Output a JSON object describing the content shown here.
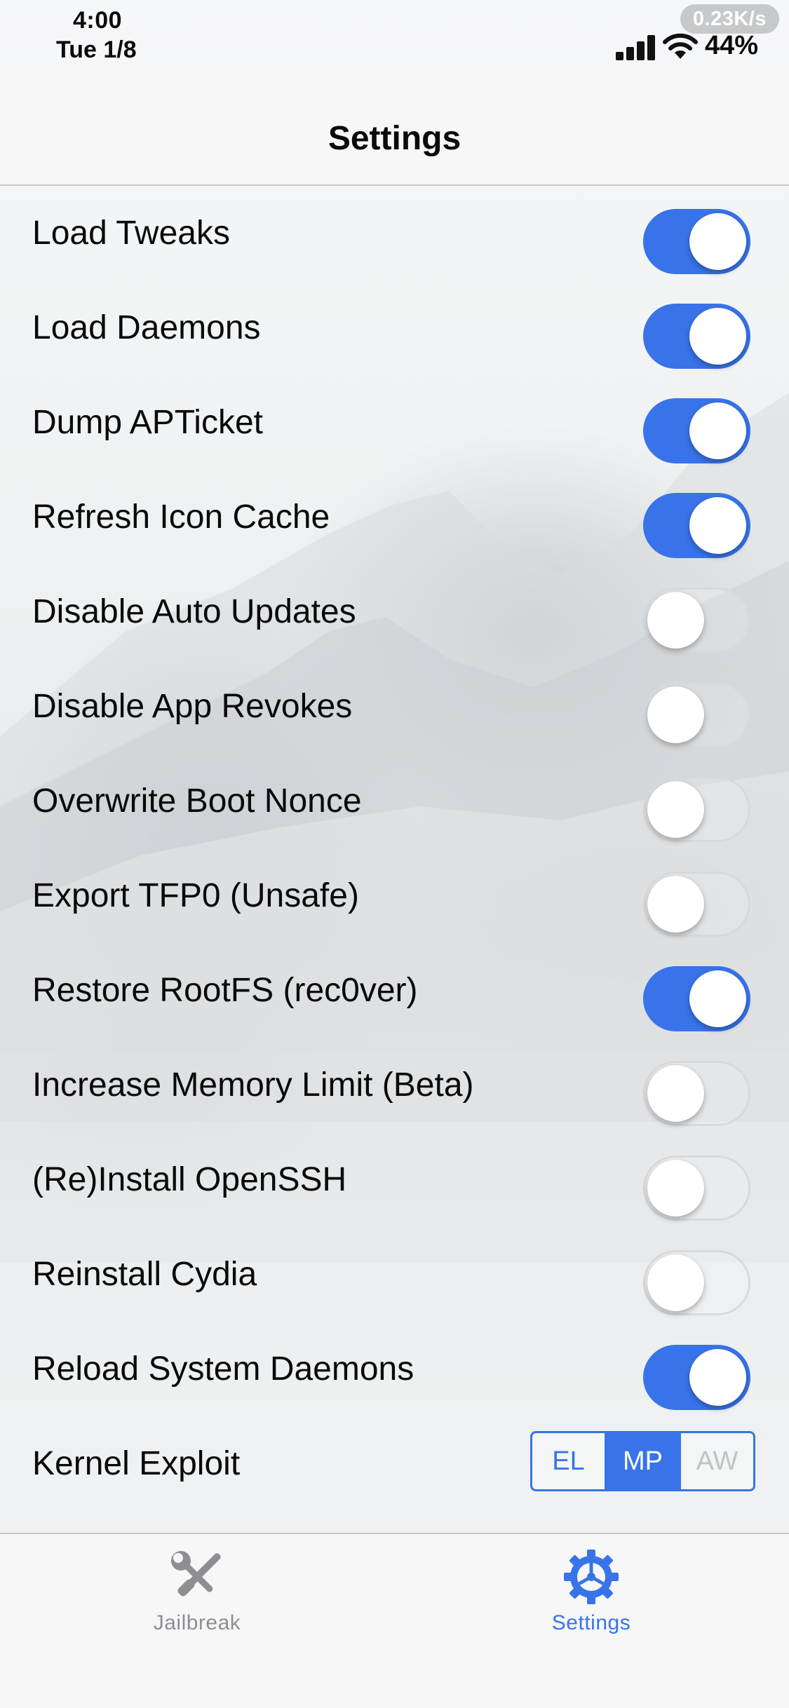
{
  "status_bar": {
    "time": "4:00",
    "date": "Tue 1/8",
    "network_speed": "0.23K/s",
    "battery": "44%",
    "signal_icon": "cellular-signal-icon",
    "wifi_icon": "wifi-icon"
  },
  "nav": {
    "title": "Settings"
  },
  "settings": [
    {
      "label": "Load Tweaks",
      "on": true
    },
    {
      "label": "Load Daemons",
      "on": true
    },
    {
      "label": "Dump APTicket",
      "on": true
    },
    {
      "label": "Refresh Icon Cache",
      "on": true
    },
    {
      "label": "Disable Auto Updates",
      "on": false
    },
    {
      "label": "Disable App Revokes",
      "on": false
    },
    {
      "label": "Overwrite Boot Nonce",
      "on": false
    },
    {
      "label": "Export TFP0 (Unsafe)",
      "on": false
    },
    {
      "label": "Restore RootFS (rec0ver)",
      "on": true
    },
    {
      "label": "Increase Memory Limit (Beta)",
      "on": false
    },
    {
      "label": "(Re)Install OpenSSH",
      "on": false
    },
    {
      "label": "Reinstall Cydia",
      "on": false
    },
    {
      "label": "Reload System Daemons",
      "on": true
    }
  ],
  "kernel_exploit": {
    "label": "Kernel Exploit",
    "options": [
      {
        "label": "EL",
        "state": "normal"
      },
      {
        "label": "MP",
        "state": "selected"
      },
      {
        "label": "AW",
        "state": "disabled"
      }
    ]
  },
  "tabbar": {
    "items": [
      {
        "label": "Jailbreak",
        "icon": "tools-icon",
        "active": false
      },
      {
        "label": "Settings",
        "icon": "gear-icon",
        "active": true
      }
    ]
  },
  "colors": {
    "accent": "#3873e9",
    "switch_off_border": "#d7d8da",
    "inactive_tab": "#8e8e93"
  }
}
